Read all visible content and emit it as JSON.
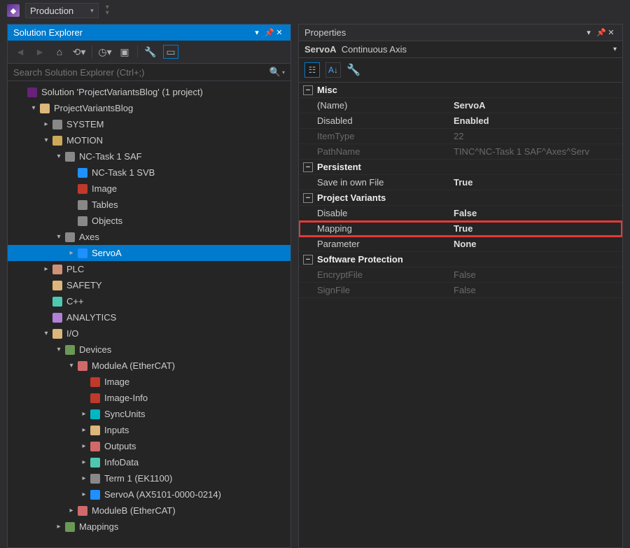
{
  "toolbar": {
    "config": "Production"
  },
  "solutionExplorer": {
    "title": "Solution Explorer",
    "searchPlaceholder": "Search Solution Explorer (Ctrl+;)",
    "tree": [
      {
        "d": 0,
        "a": "none",
        "i": "i-vs",
        "t": "Solution 'ProjectVariantsBlog' (1 project)"
      },
      {
        "d": 1,
        "a": "exp",
        "i": "i-yellow",
        "t": "ProjectVariantsBlog"
      },
      {
        "d": 2,
        "a": "col",
        "i": "i-grey",
        "t": "SYSTEM"
      },
      {
        "d": 2,
        "a": "exp",
        "i": "i-motion",
        "t": "MOTION"
      },
      {
        "d": 3,
        "a": "exp",
        "i": "i-grey",
        "t": "NC-Task 1 SAF"
      },
      {
        "d": 4,
        "a": "none",
        "i": "i-blue",
        "t": "NC-Task 1 SVB"
      },
      {
        "d": 4,
        "a": "none",
        "i": "i-redarrow",
        "t": "Image"
      },
      {
        "d": 4,
        "a": "none",
        "i": "i-grey",
        "t": "Tables"
      },
      {
        "d": 4,
        "a": "none",
        "i": "i-grey",
        "t": "Objects"
      },
      {
        "d": 3,
        "a": "exp",
        "i": "i-grey",
        "t": "Axes"
      },
      {
        "d": 4,
        "a": "col",
        "i": "i-blue",
        "t": "ServoA",
        "sel": true
      },
      {
        "d": 2,
        "a": "col",
        "i": "i-orange",
        "t": "PLC"
      },
      {
        "d": 2,
        "a": "none",
        "i": "i-yellow",
        "t": "SAFETY"
      },
      {
        "d": 2,
        "a": "none",
        "i": "i-teal",
        "t": "C++"
      },
      {
        "d": 2,
        "a": "none",
        "i": "i-purple",
        "t": "ANALYTICS"
      },
      {
        "d": 2,
        "a": "exp",
        "i": "i-yellow",
        "t": "I/O"
      },
      {
        "d": 3,
        "a": "exp",
        "i": "i-green",
        "t": "Devices"
      },
      {
        "d": 4,
        "a": "exp",
        "i": "i-red",
        "t": "ModuleA (EtherCAT)"
      },
      {
        "d": 5,
        "a": "none",
        "i": "i-redarrow",
        "t": "Image"
      },
      {
        "d": 5,
        "a": "none",
        "i": "i-redarrow",
        "t": "Image-Info"
      },
      {
        "d": 5,
        "a": "col",
        "i": "i-cyan",
        "t": "SyncUnits"
      },
      {
        "d": 5,
        "a": "col",
        "i": "i-folder",
        "t": "Inputs"
      },
      {
        "d": 5,
        "a": "col",
        "i": "i-red",
        "t": "Outputs"
      },
      {
        "d": 5,
        "a": "col",
        "i": "i-teal",
        "t": "InfoData"
      },
      {
        "d": 5,
        "a": "col",
        "i": "i-grey",
        "t": "Term 1 (EK1100)"
      },
      {
        "d": 5,
        "a": "col",
        "i": "i-blue",
        "t": "ServoA (AX5101-0000-0214)"
      },
      {
        "d": 4,
        "a": "col",
        "i": "i-red",
        "t": "ModuleB (EtherCAT)"
      },
      {
        "d": 3,
        "a": "col",
        "i": "i-green",
        "t": "Mappings"
      }
    ]
  },
  "properties": {
    "title": "Properties",
    "headerName": "ServoA",
    "headerType": "Continuous Axis",
    "groups": [
      {
        "name": "Misc",
        "rows": [
          {
            "n": "(Name)",
            "v": "ServoA",
            "vb": true
          },
          {
            "n": "Disabled",
            "v": "Enabled",
            "vb": true
          },
          {
            "n": "ItemType",
            "v": "22",
            "dim": true
          },
          {
            "n": "PathName",
            "v": "TINC^NC-Task 1 SAF^Axes^Serv",
            "dim": true
          }
        ]
      },
      {
        "name": "Persistent",
        "rows": [
          {
            "n": "Save in own File",
            "v": "True",
            "vb": true
          }
        ]
      },
      {
        "name": "Project Variants",
        "rows": [
          {
            "n": "Disable",
            "v": "False",
            "vb": true
          },
          {
            "n": "Mapping",
            "v": "True",
            "vb": true,
            "hl": true
          },
          {
            "n": "Parameter",
            "v": "None",
            "vb": true
          }
        ]
      },
      {
        "name": "Software Protection",
        "rows": [
          {
            "n": "EncryptFile",
            "v": "False",
            "dim": true
          },
          {
            "n": "SignFile",
            "v": "False",
            "dim": true
          }
        ]
      }
    ]
  }
}
